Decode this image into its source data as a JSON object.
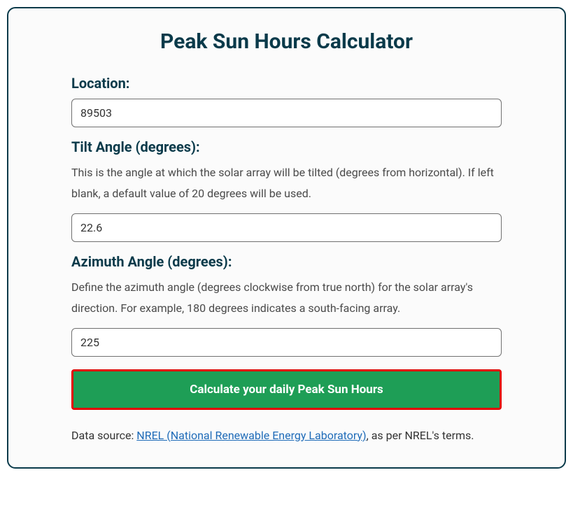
{
  "title": "Peak Sun Hours Calculator",
  "location": {
    "label": "Location:",
    "value": "89503"
  },
  "tilt": {
    "label": "Tilt Angle (degrees):",
    "helper": "This is the angle at which the solar array will be tilted (degrees from horizontal). If left blank, a default value of 20 degrees will be used.",
    "value": "22.6"
  },
  "azimuth": {
    "label": "Azimuth Angle (degrees):",
    "helper": "Define the azimuth angle (degrees clockwise from true north) for the solar array's direction. For example, 180 degrees indicates a south-facing array.",
    "value": "225"
  },
  "button_label": "Calculate your daily Peak Sun Hours",
  "footer": {
    "prefix": "Data source: ",
    "link_text": "NREL (National Renewable Energy Laboratory)",
    "suffix": ", as per NREL's terms."
  }
}
